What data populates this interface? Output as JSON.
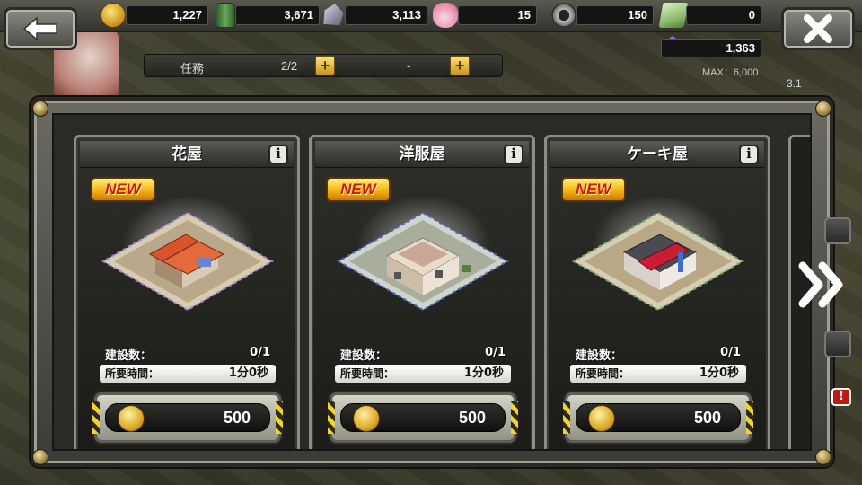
{
  "resources": {
    "gold": "1,227",
    "oil": "3,671",
    "iron": "3,113",
    "bag": "15",
    "parts": "150",
    "cash": "0",
    "crystal": "1,363"
  },
  "crystal_max": "MAX：6,000",
  "mission": {
    "label": "任務",
    "count": "2/2",
    "dash": "-"
  },
  "side_value": "3.1",
  "cards": [
    {
      "title": "花屋",
      "badge": "NEW",
      "build_label": "建設数：",
      "build_value": "0/1",
      "time_label": "所要時間：",
      "time_value": "1分0秒",
      "price": "500",
      "roof_color": "#d8542c"
    },
    {
      "title": "洋服屋",
      "badge": "NEW",
      "build_label": "建設数：",
      "build_value": "0/1",
      "time_label": "所要時間：",
      "time_value": "1分0秒",
      "price": "500",
      "roof_color": "#e8dccb"
    },
    {
      "title": "ケーキ屋",
      "badge": "NEW",
      "build_label": "建設数：",
      "build_value": "0/1",
      "time_label": "所要時間：",
      "time_value": "1分0秒",
      "price": "500",
      "roof_color": "#c81d35"
    }
  ],
  "alert_mark": "!",
  "colors": {
    "badge_text": "#d0190c",
    "hazard_yellow": "#f2d329",
    "gold": "#d7a31e"
  },
  "icons": [
    "back-arrow-icon",
    "close-x-icon",
    "gold-coin-icon",
    "oil-barrel-icon",
    "iron-ore-icon",
    "pouch-icon",
    "gear-parts-icon",
    "cash-bundle-icon",
    "crystal-icon",
    "info-icon",
    "next-chevron-icon"
  ]
}
